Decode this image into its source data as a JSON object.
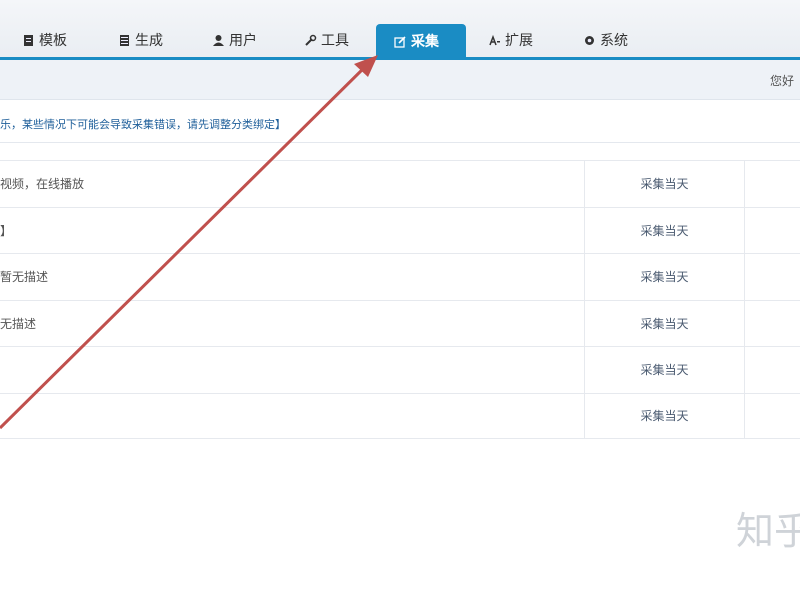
{
  "nav": {
    "items": [
      {
        "label": "模板",
        "icon": "file-icon"
      },
      {
        "label": "生成",
        "icon": "book-icon"
      },
      {
        "label": "用户",
        "icon": "user-icon"
      },
      {
        "label": "工具",
        "icon": "wrench-icon"
      },
      {
        "label": "采集",
        "icon": "edit-icon",
        "active": true
      },
      {
        "label": "扩展",
        "icon": "extension-icon"
      },
      {
        "label": "系统",
        "icon": "gear-icon"
      }
    ]
  },
  "subbar": {
    "right_text": "您好"
  },
  "notice": "乐，某些情况下可能会导致采集错误，请先调整分类绑定】",
  "rows": [
    {
      "name": "视频，在线播放",
      "action": "采集当天"
    },
    {
      "name": "】",
      "action": "采集当天"
    },
    {
      "name": "暂无描述",
      "action": "采集当天"
    },
    {
      "name": "无描述",
      "action": "采集当天"
    },
    {
      "name": "",
      "action": "采集当天"
    },
    {
      "name": "",
      "action": "采集当天"
    }
  ],
  "watermark": "知乎",
  "colors": {
    "accent": "#1a8cc4",
    "annotation": "#c0504d"
  }
}
